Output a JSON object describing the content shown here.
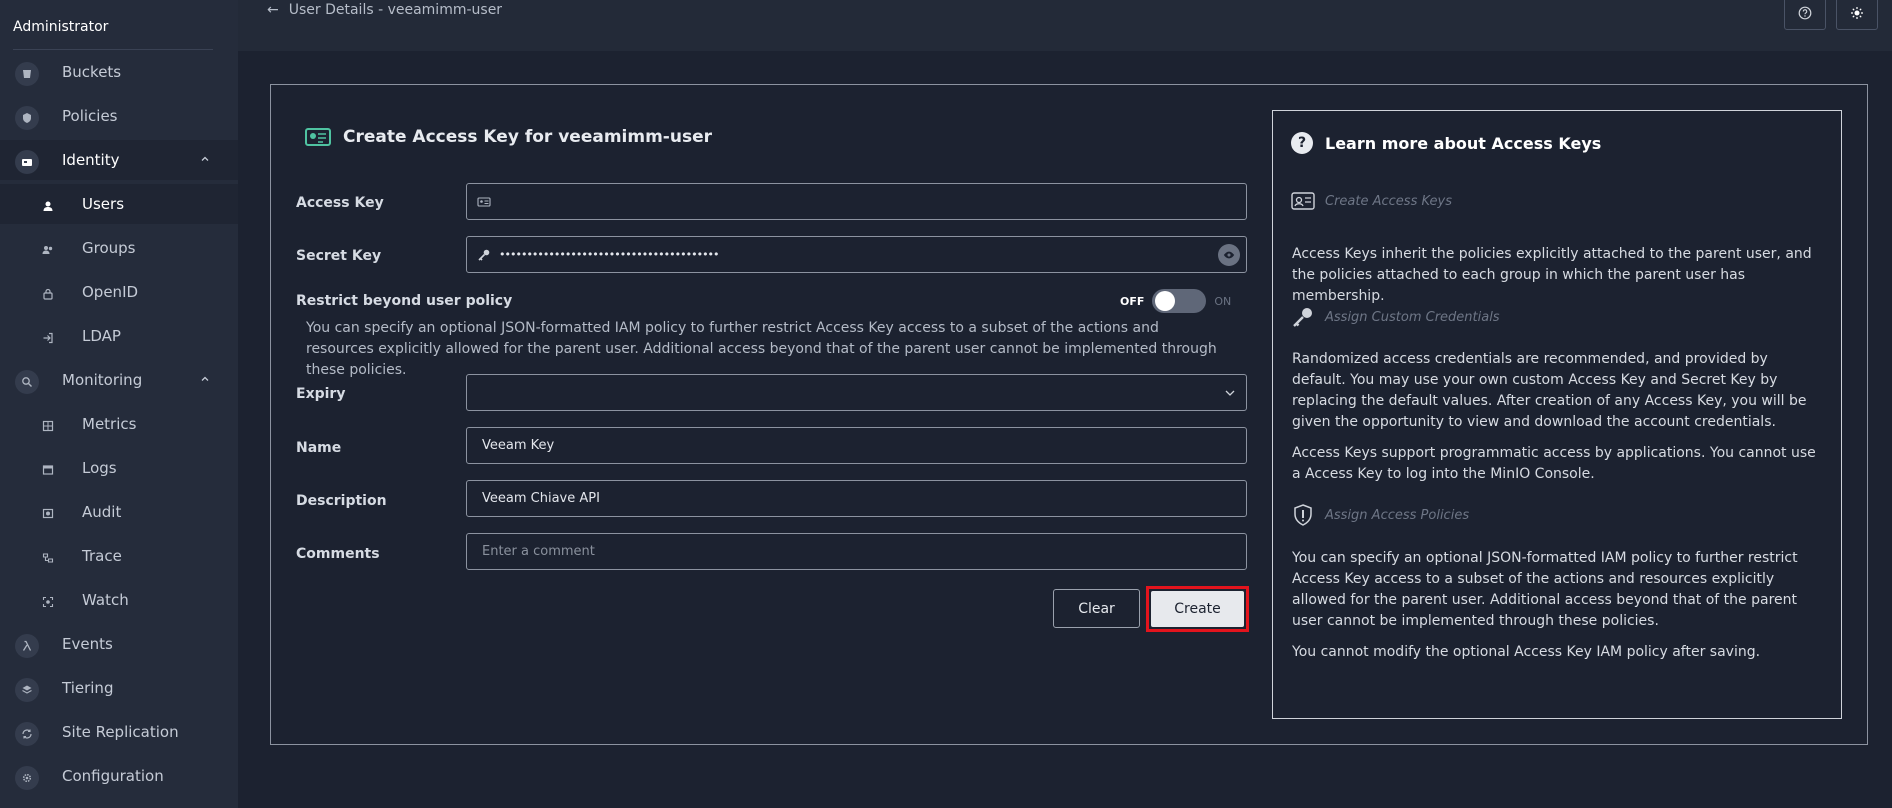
{
  "sidebar": {
    "title": "Administrator",
    "items": [
      {
        "label": "Buckets",
        "icon": "bucket-icon"
      },
      {
        "label": "Policies",
        "icon": "shield-icon"
      },
      {
        "label": "Identity",
        "icon": "id-card-icon"
      },
      {
        "label": "Users",
        "icon": "user-icon"
      },
      {
        "label": "Groups",
        "icon": "group-icon"
      },
      {
        "label": "OpenID",
        "icon": "lock-icon"
      },
      {
        "label": "LDAP",
        "icon": "login-icon"
      },
      {
        "label": "Monitoring",
        "icon": "search-icon"
      },
      {
        "label": "Metrics",
        "icon": "metrics-icon"
      },
      {
        "label": "Logs",
        "icon": "logs-icon"
      },
      {
        "label": "Audit",
        "icon": "audit-icon"
      },
      {
        "label": "Trace",
        "icon": "trace-icon"
      },
      {
        "label": "Watch",
        "icon": "watch-icon"
      },
      {
        "label": "Events",
        "icon": "lambda-icon"
      },
      {
        "label": "Tiering",
        "icon": "layers-icon"
      },
      {
        "label": "Site Replication",
        "icon": "replication-icon"
      },
      {
        "label": "Configuration",
        "icon": "gear-icon"
      }
    ]
  },
  "header": {
    "back_label": "User Details - veeamimm-user"
  },
  "form": {
    "title": "Create Access Key for veeamimm-user",
    "access_key_label": "Access Key",
    "access_key_value": "",
    "secret_key_label": "Secret Key",
    "secret_key_value": "••••••••••••••••••••••••••••••••••••••••",
    "restrict_label": "Restrict beyond user policy",
    "toggle_off": "OFF",
    "toggle_on": "ON",
    "restrict_enabled": false,
    "restrict_description": "You can specify an optional JSON-formatted IAM policy to further restrict Access Key access to a subset of the actions and resources explicitly allowed for the parent user. Additional access beyond that of the parent user cannot be implemented through these policies.",
    "expiry_label": "Expiry",
    "expiry_value": "",
    "name_label": "Name",
    "name_value": "Veeam Key",
    "description_label": "Description",
    "description_value": "Veeam Chiave API",
    "comments_label": "Comments",
    "comments_placeholder": "Enter a comment",
    "clear_label": "Clear",
    "create_label": "Create"
  },
  "help": {
    "title": "Learn more about Access Keys",
    "create_heading": "Create Access Keys",
    "create_text": "Access Keys inherit the policies explicitly attached to the parent user, and the policies attached to each group in which the parent user has membership.",
    "custom_heading": "Assign Custom Credentials",
    "custom_text": "Randomized access credentials are recommended, and provided by default. You may use your own custom Access Key and Secret Key by replacing the default values. After creation of any Access Key, you will be given the opportunity to view and download the account credentials.",
    "programmatic_text": "Access Keys support programmatic access by applications. You cannot use a Access Key to log into the MinIO Console.",
    "policies_heading": "Assign Access Policies",
    "policies_text": "You can specify an optional JSON-formatted IAM policy to further restrict Access Key access to a subset of the actions and resources explicitly allowed for the parent user. Additional access beyond that of the parent user cannot be implemented through these policies.",
    "modify_text": "You cannot modify the optional Access Key IAM policy after saving."
  },
  "colors": {
    "background": "#1c2230",
    "sidebar": "#252c3b",
    "highlight": "#e3141d",
    "accent": "#4fc3a1"
  }
}
